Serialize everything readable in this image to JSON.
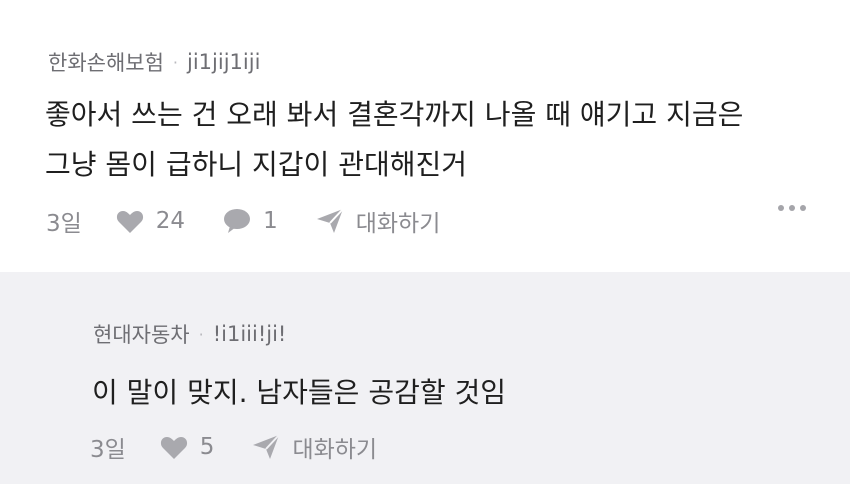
{
  "comments": [
    {
      "author": "한화손해보험",
      "handle": "ji1jij1iji",
      "text_line1": "좋아서 쓰는 건 오래 봐서 결혼각까지 나올 때 얘기고 지금은",
      "text_line2": "그냥 몸이 급하니 지갑이 관대해진거",
      "age": "3일",
      "likes": "24",
      "replies": "1",
      "conversation_label": "대화하기"
    },
    {
      "author": "현대자동차",
      "handle": "!i1iii!ji!",
      "text_line1": "이 말이 맞지. 남자들은 공감할 것임",
      "age": "3일",
      "likes": "5",
      "conversation_label": "대화하기"
    }
  ],
  "meta_separator": "·",
  "icons": [
    "heart-icon",
    "speech-bubble-icon",
    "send-icon",
    "more-icon"
  ],
  "colors": {
    "reply_background": "#f1f1f4",
    "meta_text": "#6e6e73",
    "action_icon": "#a9a9ae"
  }
}
